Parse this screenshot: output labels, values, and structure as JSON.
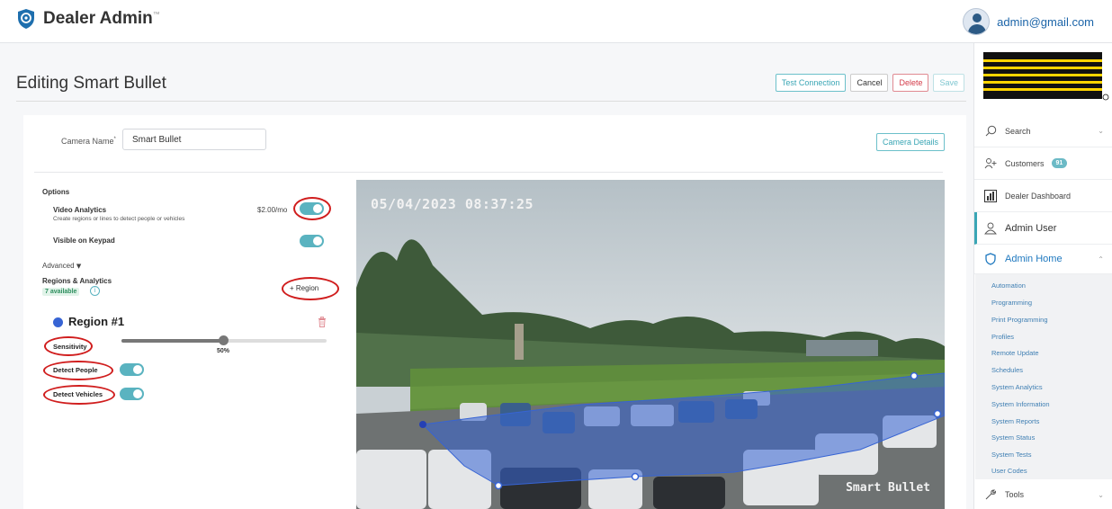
{
  "app": {
    "brand": "Dealer Admin",
    "trademark": "™"
  },
  "user": {
    "email": "admin@gmail.com"
  },
  "page": {
    "title": "Editing Smart Bullet"
  },
  "actions": {
    "test_connection": "Test Connection",
    "cancel": "Cancel",
    "delete": "Delete",
    "save": "Save"
  },
  "camera": {
    "name_label": "Camera Name",
    "required_marker": "*",
    "name_value": "Smart Bullet",
    "details_button": "Camera Details",
    "timestamp": "05/04/2023 08:37:25",
    "overlay_name": "Smart Bullet"
  },
  "options": {
    "title": "Options",
    "video_analytics": {
      "title": "Video Analytics",
      "description": "Create regions or lines to detect people or vehicles",
      "price": "$2.00/mo",
      "enabled": true
    },
    "visible_on_keypad": {
      "title": "Visible on Keypad",
      "enabled": true
    },
    "advanced_label": "Advanced",
    "regions": {
      "title": "Regions & Analytics",
      "available": "7 available",
      "add_button": "+ Region"
    }
  },
  "region": {
    "name": "Region #1",
    "color": "#3764d4",
    "sensitivity_label": "Sensitivity",
    "sensitivity_value": "50%",
    "sensitivity_level": 0.5,
    "detect_people_label": "Detect People",
    "detect_people": true,
    "detect_vehicles_label": "Detect Vehicles",
    "detect_vehicles": true
  },
  "sidebar": {
    "brand_logo": "DMP",
    "items": [
      {
        "label": "Search",
        "icon": "search-icon"
      },
      {
        "label": "Customers",
        "icon": "customers-icon",
        "badge": "91"
      },
      {
        "label": "Dealer Dashboard",
        "icon": "dashboard-icon"
      },
      {
        "label": "Admin User",
        "icon": "user-icon"
      },
      {
        "label": "Admin Home",
        "icon": "shield-icon"
      }
    ],
    "subitems": [
      "Automation",
      "Programming",
      "Print Programming",
      "Profiles",
      "Remote Update",
      "Schedules",
      "System Analytics",
      "System Information",
      "System Reports",
      "System Status",
      "System Tests",
      "User Codes"
    ],
    "tools": {
      "label": "Tools",
      "icon": "wrench-icon"
    }
  },
  "colors": {
    "accent": "#3aa6b5",
    "danger": "#d33b49",
    "annotation": "#d01d1d",
    "region_fill": "#3764d4"
  }
}
